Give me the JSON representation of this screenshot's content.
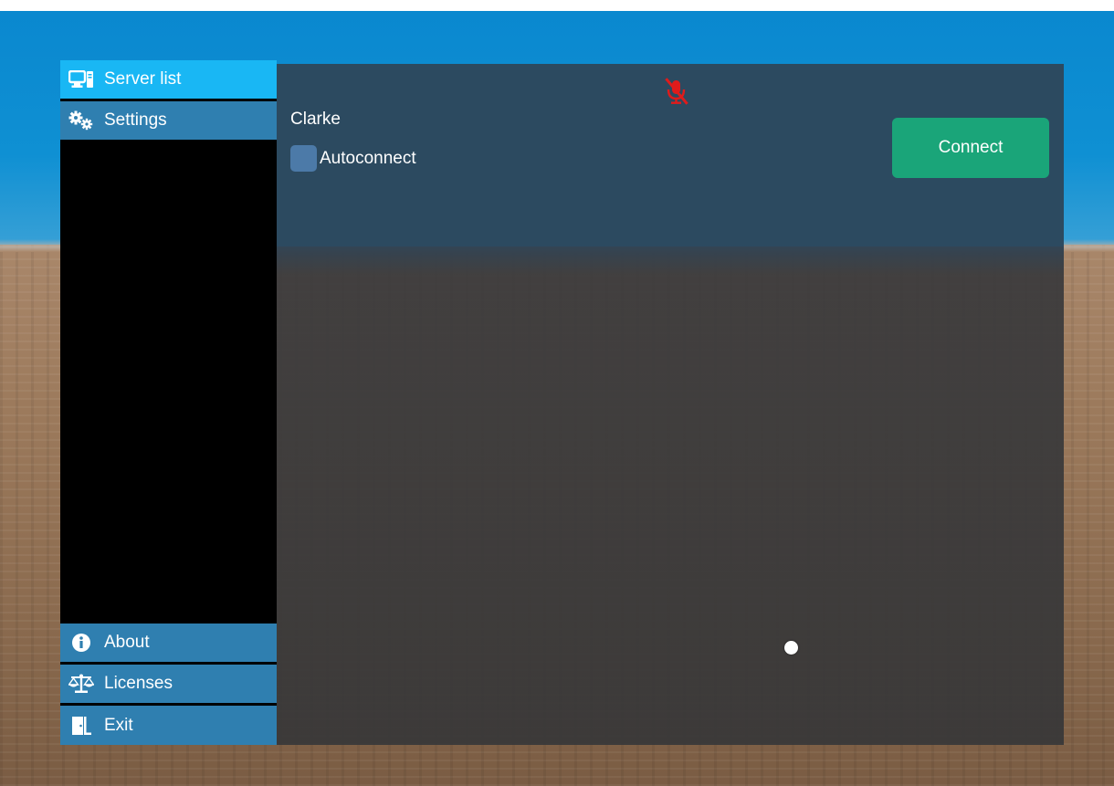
{
  "sidebar": {
    "items": [
      {
        "label": "Server list",
        "icon": "server-icon",
        "active": true
      },
      {
        "label": "Settings",
        "icon": "gears-icon",
        "active": false
      },
      {
        "label": "About",
        "icon": "info-icon",
        "active": false
      },
      {
        "label": "Licenses",
        "icon": "balance-scale-icon",
        "active": false
      },
      {
        "label": "Exit",
        "icon": "door-exit-icon",
        "active": false
      }
    ]
  },
  "main": {
    "server": {
      "name": "Clarke",
      "autoconnect_label": "Autoconnect",
      "autoconnect_checked": false
    },
    "connect_label": "Connect",
    "mic_status_icon": "mic-muted-icon"
  },
  "colors": {
    "active_nav": "#19b7f4",
    "nav": "#2f7fb0",
    "connect": "#1aa579",
    "mic_muted": "#e01b1b"
  }
}
